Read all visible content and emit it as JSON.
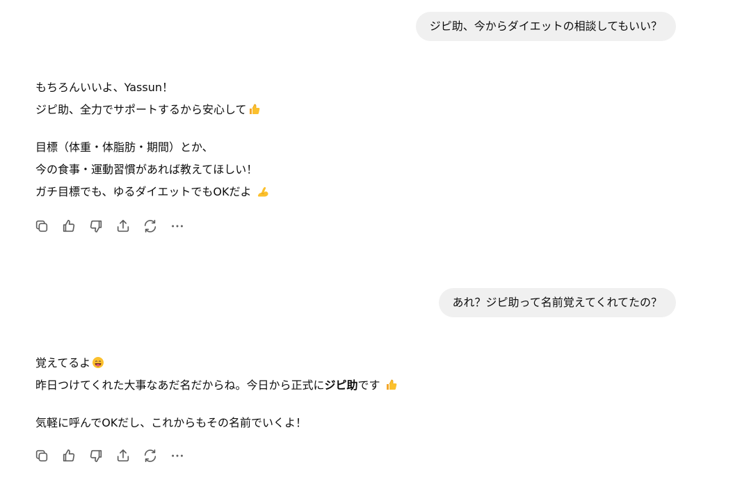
{
  "conversation": {
    "messages": [
      {
        "role": "user",
        "text": "ジピ助、今からダイエットの相談してもいい？"
      },
      {
        "role": "assistant",
        "paragraphs": [
          {
            "lines": [
              {
                "text": "もちろんいいよ、Yassun！"
              },
              {
                "text": "ジピ助、全力でサポートするから安心して",
                "emoji": "thumbs-up-emoji"
              }
            ]
          },
          {
            "lines": [
              {
                "text": "目標（体重・体脂肪・期間）とか、"
              },
              {
                "text": "今の食事・運動習慣があれば教えてほしい！"
              },
              {
                "text": "ガチ目標でも、ゆるダイエットでもOKだよ ",
                "emoji": "flexed-biceps-emoji"
              }
            ]
          }
        ]
      },
      {
        "role": "user",
        "text": "あれ？ジピ助って名前覚えてくれてたの？"
      },
      {
        "role": "assistant",
        "paragraphs": [
          {
            "lines": [
              {
                "text": "覚えてるよ",
                "emoji": "grinning-face-emoji"
              },
              {
                "prefix": "昨日つけてくれた大事なあだ名だからね。今日から正式に",
                "bold": "ジピ助",
                "suffix": "です ",
                "emoji": "thumbs-up-emoji"
              }
            ]
          },
          {
            "lines": [
              {
                "text": "気軽に呼んでOKだし、これからもその名前でいくよ！"
              }
            ]
          }
        ]
      }
    ]
  },
  "action_icons": [
    "copy-icon",
    "thumbs-up-icon",
    "thumbs-down-icon",
    "share-icon",
    "regenerate-icon",
    "more-icon"
  ],
  "colors": {
    "bubble_background": "#f0f0f0",
    "text": "#0d0d0d",
    "icon": "#5d5d5d",
    "page_background": "#ffffff"
  }
}
